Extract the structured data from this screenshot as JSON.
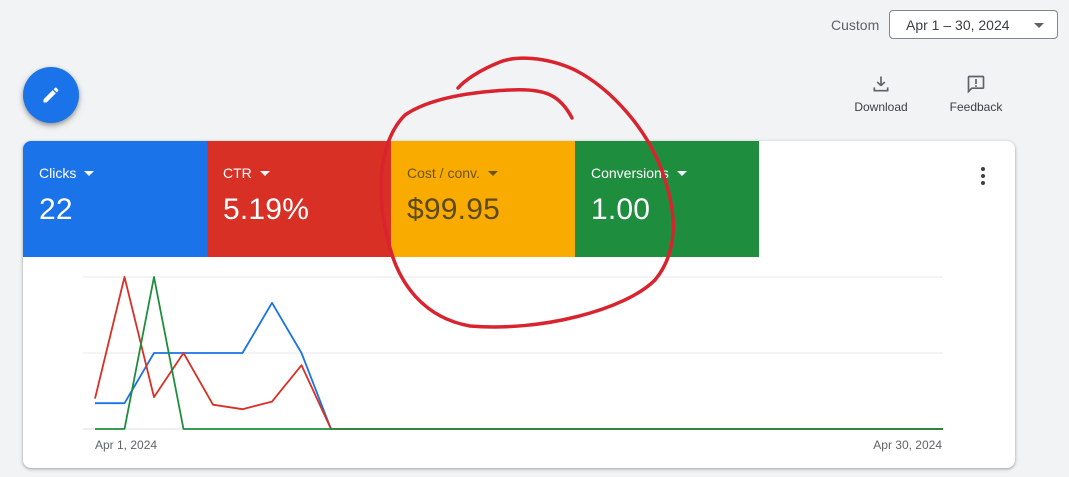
{
  "date_range": {
    "label": "Custom",
    "value": "Apr 1 – 30, 2024"
  },
  "fab": {
    "icon": "pencil-icon"
  },
  "toolbar": {
    "download_label": "Download",
    "download_icon": "download-icon",
    "feedback_label": "Feedback",
    "feedback_icon": "feedback-icon"
  },
  "metrics": [
    {
      "label": "Clicks",
      "value": "22",
      "color": "#1a73e8"
    },
    {
      "label": "CTR",
      "value": "5.19%",
      "color": "#d93025"
    },
    {
      "label": "Cost / conv.",
      "value": "$99.95",
      "color": "#f9ab00"
    },
    {
      "label": "Conversions",
      "value": "1.00",
      "color": "#1e8e3e"
    }
  ],
  "chart_data": {
    "type": "line",
    "x_start_label": "Apr 1, 2024",
    "x_end_label": "Apr 30, 2024",
    "grid": true,
    "ylim": [
      0,
      1
    ],
    "series": [
      {
        "color": "#1a73e8",
        "values": [
          0.17,
          0.17,
          0.5,
          0.5,
          0.5,
          0.5,
          0.83,
          0.5,
          0,
          0,
          0,
          0,
          0,
          0,
          0,
          0,
          0,
          0,
          0,
          0,
          0,
          0,
          0,
          0,
          0,
          0,
          0,
          0,
          0,
          0
        ]
      },
      {
        "color": "#d93025",
        "values": [
          0.2,
          1.0,
          0.21,
          0.5,
          0.16,
          0.13,
          0.18,
          0.42,
          0,
          0,
          0,
          0,
          0,
          0,
          0,
          0,
          0,
          0,
          0,
          0,
          0,
          0,
          0,
          0,
          0,
          0,
          0,
          0,
          0,
          0
        ]
      },
      {
        "color": "#1e8e3e",
        "values": [
          0,
          0,
          1.0,
          0,
          0,
          0,
          0,
          0,
          0,
          0,
          0,
          0,
          0,
          0,
          0,
          0,
          0,
          0,
          0,
          0,
          0,
          0,
          0,
          0,
          0,
          0,
          0,
          0,
          0,
          0
        ]
      }
    ]
  },
  "annotation": {
    "color": "#d9232e",
    "shape": "hand-drawn-circle"
  }
}
